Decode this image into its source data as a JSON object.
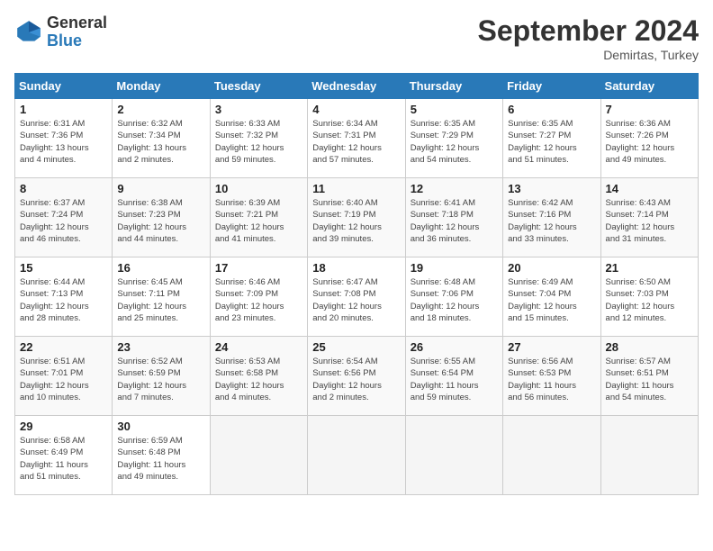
{
  "logo": {
    "line1": "General",
    "line2": "Blue"
  },
  "title": "September 2024",
  "subtitle": "Demirtas, Turkey",
  "days_of_week": [
    "Sunday",
    "Monday",
    "Tuesday",
    "Wednesday",
    "Thursday",
    "Friday",
    "Saturday"
  ],
  "weeks": [
    [
      {
        "day": "1",
        "info": "Sunrise: 6:31 AM\nSunset: 7:36 PM\nDaylight: 13 hours\nand 4 minutes."
      },
      {
        "day": "2",
        "info": "Sunrise: 6:32 AM\nSunset: 7:34 PM\nDaylight: 13 hours\nand 2 minutes."
      },
      {
        "day": "3",
        "info": "Sunrise: 6:33 AM\nSunset: 7:32 PM\nDaylight: 12 hours\nand 59 minutes."
      },
      {
        "day": "4",
        "info": "Sunrise: 6:34 AM\nSunset: 7:31 PM\nDaylight: 12 hours\nand 57 minutes."
      },
      {
        "day": "5",
        "info": "Sunrise: 6:35 AM\nSunset: 7:29 PM\nDaylight: 12 hours\nand 54 minutes."
      },
      {
        "day": "6",
        "info": "Sunrise: 6:35 AM\nSunset: 7:27 PM\nDaylight: 12 hours\nand 51 minutes."
      },
      {
        "day": "7",
        "info": "Sunrise: 6:36 AM\nSunset: 7:26 PM\nDaylight: 12 hours\nand 49 minutes."
      }
    ],
    [
      {
        "day": "8",
        "info": "Sunrise: 6:37 AM\nSunset: 7:24 PM\nDaylight: 12 hours\nand 46 minutes."
      },
      {
        "day": "9",
        "info": "Sunrise: 6:38 AM\nSunset: 7:23 PM\nDaylight: 12 hours\nand 44 minutes."
      },
      {
        "day": "10",
        "info": "Sunrise: 6:39 AM\nSunset: 7:21 PM\nDaylight: 12 hours\nand 41 minutes."
      },
      {
        "day": "11",
        "info": "Sunrise: 6:40 AM\nSunset: 7:19 PM\nDaylight: 12 hours\nand 39 minutes."
      },
      {
        "day": "12",
        "info": "Sunrise: 6:41 AM\nSunset: 7:18 PM\nDaylight: 12 hours\nand 36 minutes."
      },
      {
        "day": "13",
        "info": "Sunrise: 6:42 AM\nSunset: 7:16 PM\nDaylight: 12 hours\nand 33 minutes."
      },
      {
        "day": "14",
        "info": "Sunrise: 6:43 AM\nSunset: 7:14 PM\nDaylight: 12 hours\nand 31 minutes."
      }
    ],
    [
      {
        "day": "15",
        "info": "Sunrise: 6:44 AM\nSunset: 7:13 PM\nDaylight: 12 hours\nand 28 minutes."
      },
      {
        "day": "16",
        "info": "Sunrise: 6:45 AM\nSunset: 7:11 PM\nDaylight: 12 hours\nand 25 minutes."
      },
      {
        "day": "17",
        "info": "Sunrise: 6:46 AM\nSunset: 7:09 PM\nDaylight: 12 hours\nand 23 minutes."
      },
      {
        "day": "18",
        "info": "Sunrise: 6:47 AM\nSunset: 7:08 PM\nDaylight: 12 hours\nand 20 minutes."
      },
      {
        "day": "19",
        "info": "Sunrise: 6:48 AM\nSunset: 7:06 PM\nDaylight: 12 hours\nand 18 minutes."
      },
      {
        "day": "20",
        "info": "Sunrise: 6:49 AM\nSunset: 7:04 PM\nDaylight: 12 hours\nand 15 minutes."
      },
      {
        "day": "21",
        "info": "Sunrise: 6:50 AM\nSunset: 7:03 PM\nDaylight: 12 hours\nand 12 minutes."
      }
    ],
    [
      {
        "day": "22",
        "info": "Sunrise: 6:51 AM\nSunset: 7:01 PM\nDaylight: 12 hours\nand 10 minutes."
      },
      {
        "day": "23",
        "info": "Sunrise: 6:52 AM\nSunset: 6:59 PM\nDaylight: 12 hours\nand 7 minutes."
      },
      {
        "day": "24",
        "info": "Sunrise: 6:53 AM\nSunset: 6:58 PM\nDaylight: 12 hours\nand 4 minutes."
      },
      {
        "day": "25",
        "info": "Sunrise: 6:54 AM\nSunset: 6:56 PM\nDaylight: 12 hours\nand 2 minutes."
      },
      {
        "day": "26",
        "info": "Sunrise: 6:55 AM\nSunset: 6:54 PM\nDaylight: 11 hours\nand 59 minutes."
      },
      {
        "day": "27",
        "info": "Sunrise: 6:56 AM\nSunset: 6:53 PM\nDaylight: 11 hours\nand 56 minutes."
      },
      {
        "day": "28",
        "info": "Sunrise: 6:57 AM\nSunset: 6:51 PM\nDaylight: 11 hours\nand 54 minutes."
      }
    ],
    [
      {
        "day": "29",
        "info": "Sunrise: 6:58 AM\nSunset: 6:49 PM\nDaylight: 11 hours\nand 51 minutes."
      },
      {
        "day": "30",
        "info": "Sunrise: 6:59 AM\nSunset: 6:48 PM\nDaylight: 11 hours\nand 49 minutes."
      },
      {
        "day": "",
        "info": ""
      },
      {
        "day": "",
        "info": ""
      },
      {
        "day": "",
        "info": ""
      },
      {
        "day": "",
        "info": ""
      },
      {
        "day": "",
        "info": ""
      }
    ]
  ]
}
